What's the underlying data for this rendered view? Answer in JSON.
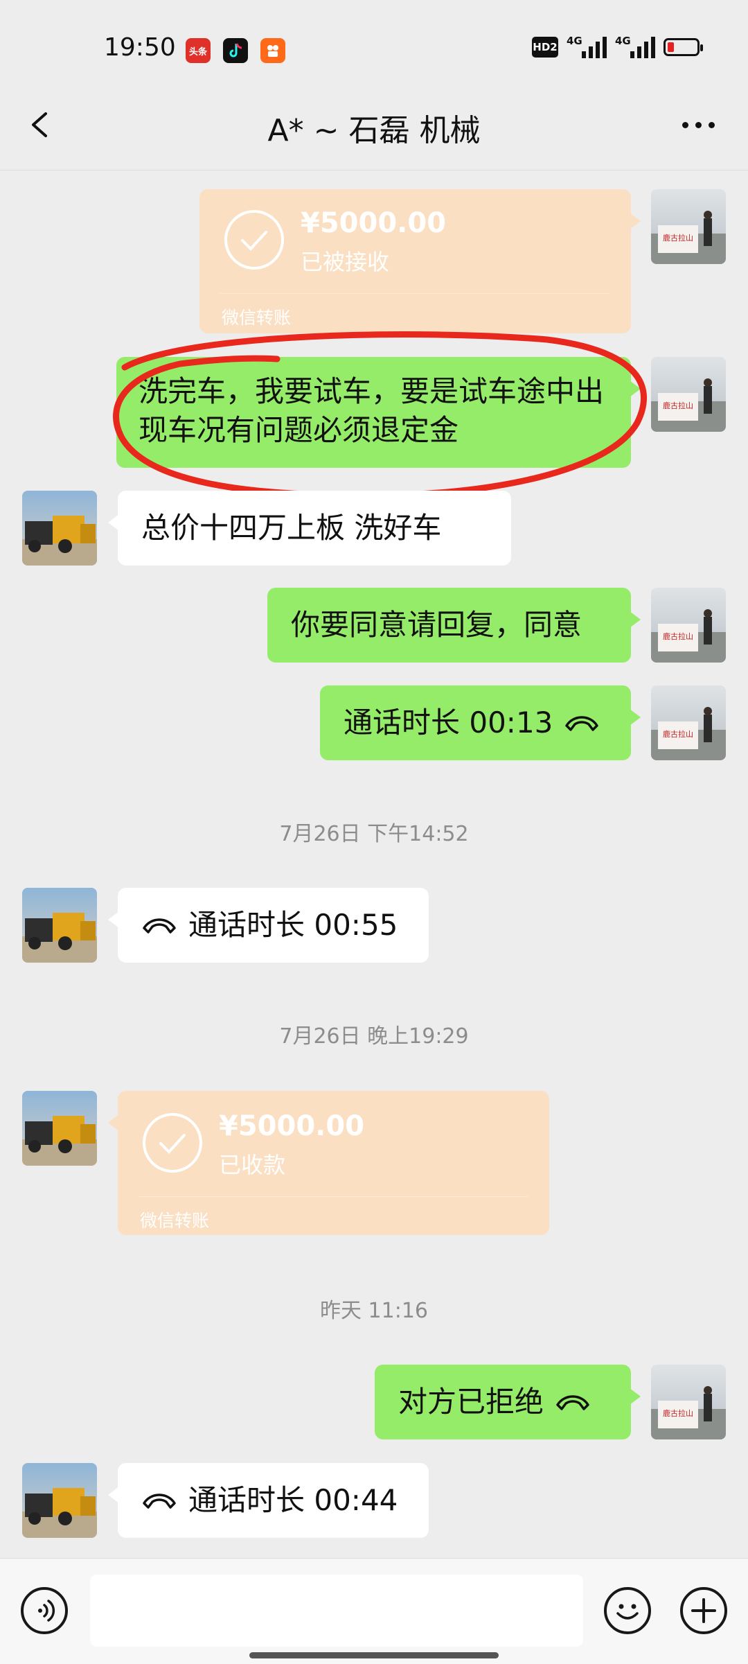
{
  "status_bar": {
    "time": "19:50",
    "apps": [
      "头条",
      "tiktok-icon",
      "kuaishou-icon"
    ],
    "hd_label": "HD2",
    "network1": "4G",
    "network2": "4G"
  },
  "header": {
    "title": "A* ~ 石磊 机械"
  },
  "messages": {
    "transfer_out": {
      "amount": "¥5000.00",
      "status": "已被接收",
      "label": "微信转账"
    },
    "msg_wash": "洗完车，我要试车，要是试车途中出现车况有问题必须退定金",
    "msg_price": "总价十四万上板   洗好车",
    "msg_agree": "你要同意请回复，同意",
    "msg_call1": "通话时长 00:13",
    "ts1": "7月26日 下午14:52",
    "msg_call2": "通话时长 00:55",
    "ts2": "7月26日 晚上19:29",
    "transfer_in": {
      "amount": "¥5000.00",
      "status": "已收款",
      "label": "微信转账"
    },
    "ts3": "昨天 11:16",
    "msg_rejected": "对方已拒绝",
    "msg_call3": "通话时长 00:44"
  },
  "colors": {
    "sent_bubble": "#95ec69",
    "received_bubble": "#ffffff",
    "transfer_bg": "#fbdfc2",
    "annotation_red": "#e8281c"
  }
}
